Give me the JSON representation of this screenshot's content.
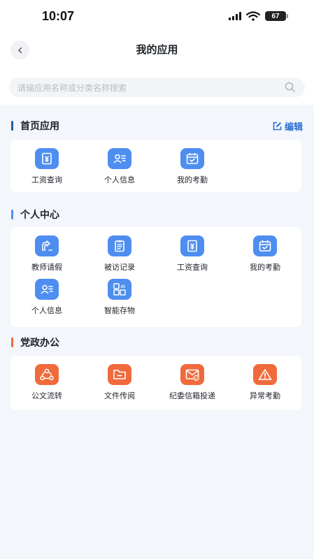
{
  "status": {
    "time": "10:07",
    "battery": "67"
  },
  "nav": {
    "title": "我的应用"
  },
  "search": {
    "placeholder": "请输应用名称或分类名称搜索"
  },
  "sections": [
    {
      "title": "首页应用",
      "accent": "#1f5f9e",
      "edit_label": "编辑",
      "apps": [
        {
          "label": "工资查询",
          "icon": "salary-icon",
          "color": "#4e8ef0"
        },
        {
          "label": "个人信息",
          "icon": "contact-card-icon",
          "color": "#4e8ef0"
        },
        {
          "label": "我的考勤",
          "icon": "calendar-check-icon",
          "color": "#4e8ef0"
        }
      ]
    },
    {
      "title": "个人中心",
      "accent": "#4e8ef0",
      "apps": [
        {
          "label": "教师请假",
          "icon": "leave-icon",
          "color": "#4e8ef0"
        },
        {
          "label": "被访记录",
          "icon": "record-icon",
          "color": "#4e8ef0"
        },
        {
          "label": "工资查询",
          "icon": "salary-icon",
          "color": "#4e8ef0"
        },
        {
          "label": "我的考勤",
          "icon": "calendar-check-icon",
          "color": "#4e8ef0"
        },
        {
          "label": "个人信息",
          "icon": "contact-card-icon",
          "color": "#4e8ef0"
        },
        {
          "label": "智能存物",
          "icon": "ai-grid-icon",
          "color": "#4e8ef0",
          "badge": "AI"
        }
      ]
    },
    {
      "title": "党政办公",
      "accent": "#ef6a3a",
      "apps": [
        {
          "label": "公文流转",
          "icon": "flow-icon",
          "color": "#f06a3c"
        },
        {
          "label": "文件传阅",
          "icon": "folder-icon",
          "color": "#f06a3c"
        },
        {
          "label": "纪委信箱投递",
          "icon": "mailbox-icon",
          "color": "#f06a3c",
          "badge": "纪"
        },
        {
          "label": "异常考勤",
          "icon": "warning-icon",
          "color": "#f06a3c"
        }
      ]
    }
  ]
}
